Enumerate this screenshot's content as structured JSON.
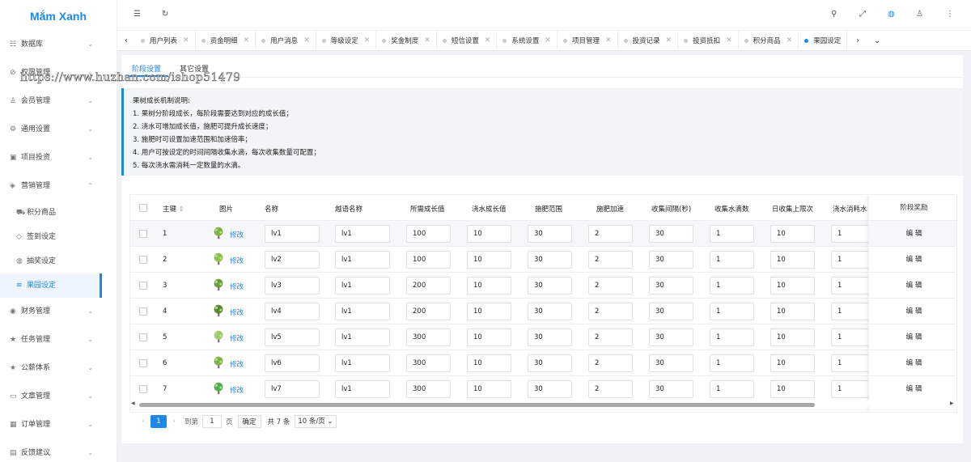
{
  "app": {
    "title": "Mắm Xanh"
  },
  "watermark": "https://www.huzhan.com/ishop51479",
  "header": {
    "icons": [
      "menu-fold-icon",
      "refresh-icon",
      "search-icon",
      "fullscreen-icon",
      "language-icon",
      "user-icon",
      "more-icon"
    ]
  },
  "sidebar": {
    "items": [
      {
        "label": "数据库",
        "icon": "database-icon",
        "expanded": false
      },
      {
        "label": "权限管理",
        "icon": "shield-icon",
        "expanded": false
      },
      {
        "label": "会员管理",
        "icon": "user-icon",
        "expanded": false
      },
      {
        "label": "通用设置",
        "icon": "gear-icon",
        "expanded": false
      },
      {
        "label": "项目投资",
        "icon": "briefcase-icon",
        "expanded": false
      },
      {
        "label": "营销管理",
        "icon": "megaphone-icon",
        "expanded": true
      },
      {
        "label": "财务管理",
        "icon": "money-icon",
        "expanded": false
      },
      {
        "label": "任务管理",
        "icon": "star-icon",
        "expanded": false
      },
      {
        "label": "公薪体系",
        "icon": "star-icon",
        "expanded": false
      },
      {
        "label": "文章管理",
        "icon": "book-icon",
        "expanded": false
      },
      {
        "label": "订单管理",
        "icon": "calendar-icon",
        "expanded": false
      },
      {
        "label": "反馈建议",
        "icon": "feedback-icon",
        "expanded": false
      }
    ],
    "subitems": [
      {
        "label": "积分商品",
        "icon": "cart-icon"
      },
      {
        "label": "签到设定",
        "icon": "tag-icon"
      },
      {
        "label": "抽奖设定",
        "icon": "compass-icon"
      },
      {
        "label": "果园设定",
        "icon": "wifi-icon",
        "active": true
      }
    ]
  },
  "tabs": [
    {
      "label": "用户列表"
    },
    {
      "label": "资金明细"
    },
    {
      "label": "用户消息"
    },
    {
      "label": "等级设定"
    },
    {
      "label": "奖金制度"
    },
    {
      "label": "短信设置"
    },
    {
      "label": "系统设置"
    },
    {
      "label": "项目管理"
    },
    {
      "label": "投资记录"
    },
    {
      "label": "投资抵扣"
    },
    {
      "label": "积分商品"
    },
    {
      "label": "果园设定",
      "active": true
    }
  ],
  "subtabs": [
    {
      "label": "阶段设置",
      "active": true
    },
    {
      "label": "其它设置"
    }
  ],
  "notice": {
    "title": "果树成长机制说明:",
    "lines": [
      "1. 果树分阶段成长，每阶段需要达到对应的成长值；",
      "2. 浇水可增加成长值，施肥可提升成长速度；",
      "3. 施肥时可设置加速范围和加速倍率；",
      "4. 用户可按设定的时间间隔收集水滴，每次收集数量可配置；",
      "5. 每次浇水需消耗一定数量的水滴。"
    ]
  },
  "table": {
    "columns": [
      "主键",
      "图片",
      "名称",
      "越语名称",
      "所需成长值",
      "浇水成长值",
      "施肥范围",
      "施肥加速",
      "收集间隔(秒)",
      "收集水滴数",
      "日收集上限次",
      "浇水消耗水",
      "阶段奖励"
    ],
    "sort_icon": "sort-icon",
    "change_label": "修改",
    "edit_label": "编 辑",
    "rows": [
      {
        "id": "1",
        "name": "lv1",
        "vi_name": "lv1",
        "grow": "100",
        "water": "10",
        "range": "30",
        "speed": "2",
        "interval": "30",
        "drops": "1",
        "limit": "10",
        "cost": "1"
      },
      {
        "id": "2",
        "name": "lv2",
        "vi_name": "lv1",
        "grow": "100",
        "water": "10",
        "range": "30",
        "speed": "2",
        "interval": "30",
        "drops": "1",
        "limit": "10",
        "cost": "1"
      },
      {
        "id": "3",
        "name": "lv3",
        "vi_name": "lv1",
        "grow": "200",
        "water": "10",
        "range": "30",
        "speed": "2",
        "interval": "30",
        "drops": "1",
        "limit": "10",
        "cost": "1"
      },
      {
        "id": "4",
        "name": "lv4",
        "vi_name": "lv1",
        "grow": "200",
        "water": "10",
        "range": "30",
        "speed": "2",
        "interval": "30",
        "drops": "1",
        "limit": "10",
        "cost": "1"
      },
      {
        "id": "5",
        "name": "lv5",
        "vi_name": "lv1",
        "grow": "300",
        "water": "10",
        "range": "30",
        "speed": "2",
        "interval": "30",
        "drops": "1",
        "limit": "10",
        "cost": "1"
      },
      {
        "id": "6",
        "name": "lv6",
        "vi_name": "lv1",
        "grow": "300",
        "water": "10",
        "range": "30",
        "speed": "2",
        "interval": "30",
        "drops": "1",
        "limit": "10",
        "cost": "1"
      },
      {
        "id": "7",
        "name": "lv7",
        "vi_name": "lv1",
        "grow": "300",
        "water": "10",
        "range": "30",
        "speed": "2",
        "interval": "30",
        "drops": "1",
        "limit": "10",
        "cost": "1"
      }
    ]
  },
  "pager": {
    "current": "1",
    "goto_label": "到第",
    "goto_value": "1",
    "page_unit": "页",
    "confirm": "确定",
    "total": "共 7 条",
    "page_size": "10 条/页"
  },
  "colors": {
    "accent": "#1e88e5"
  }
}
